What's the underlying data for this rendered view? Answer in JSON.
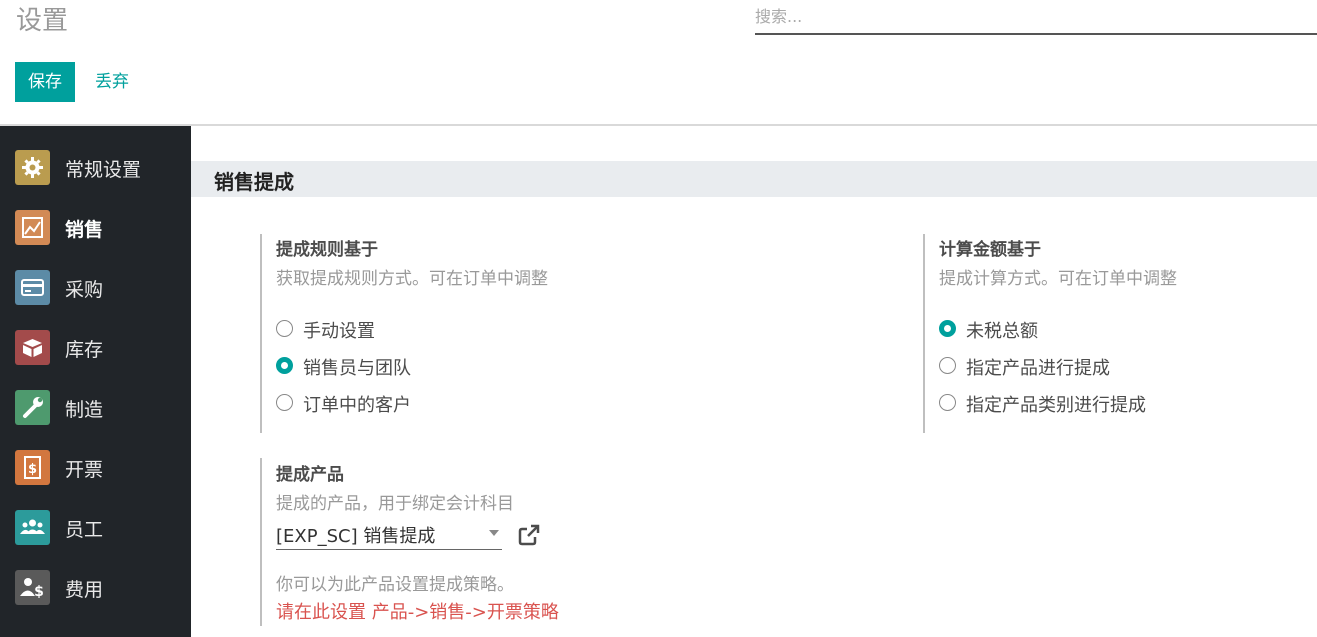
{
  "header": {
    "breadcrumb": "设置",
    "search_placeholder": "搜索...",
    "save_label": "保存",
    "discard_label": "丢弃"
  },
  "sidebar": {
    "items": [
      {
        "label": "常规设置",
        "icon": "gear-icon",
        "color": "#ba9c4f"
      },
      {
        "label": "销售",
        "icon": "sales-chart-icon",
        "color": "#d28a55",
        "active": true
      },
      {
        "label": "采购",
        "icon": "credit-card-icon",
        "color": "#5c8ba6"
      },
      {
        "label": "库存",
        "icon": "box-icon",
        "color": "#a34b4b"
      },
      {
        "label": "制造",
        "icon": "wrench-icon",
        "color": "#4e9a6e"
      },
      {
        "label": "开票",
        "icon": "invoice-icon",
        "color": "#d2773f"
      },
      {
        "label": "员工",
        "icon": "users-icon",
        "color": "#2c9b9b"
      },
      {
        "label": "费用",
        "icon": "expense-icon",
        "color": "#5a5a5a"
      }
    ]
  },
  "section": {
    "title": "销售提成",
    "rule_basis": {
      "title": "提成规则基于",
      "description": "获取提成规则方式。可在订单中调整",
      "options": [
        {
          "label": "手动设置",
          "checked": false
        },
        {
          "label": "销售员与团队",
          "checked": true
        },
        {
          "label": "订单中的客户",
          "checked": false
        }
      ]
    },
    "amount_basis": {
      "title": "计算金额基于",
      "description": "提成计算方式。可在订单中调整",
      "options": [
        {
          "label": "未税总额",
          "checked": true
        },
        {
          "label": "指定产品进行提成",
          "checked": false
        },
        {
          "label": "指定产品类别进行提成",
          "checked": false
        }
      ]
    },
    "product": {
      "title": "提成产品",
      "description": "提成的产品，用于绑定会计科目",
      "selected": "[EXP_SC] 销售提成",
      "hint": "你可以为此产品设置提成策略。",
      "link": "请在此设置 产品->销售->开票策略"
    }
  },
  "colors": {
    "accent": "#00a09d",
    "link_red": "#d9534f",
    "sidebar_bg": "#212529"
  }
}
